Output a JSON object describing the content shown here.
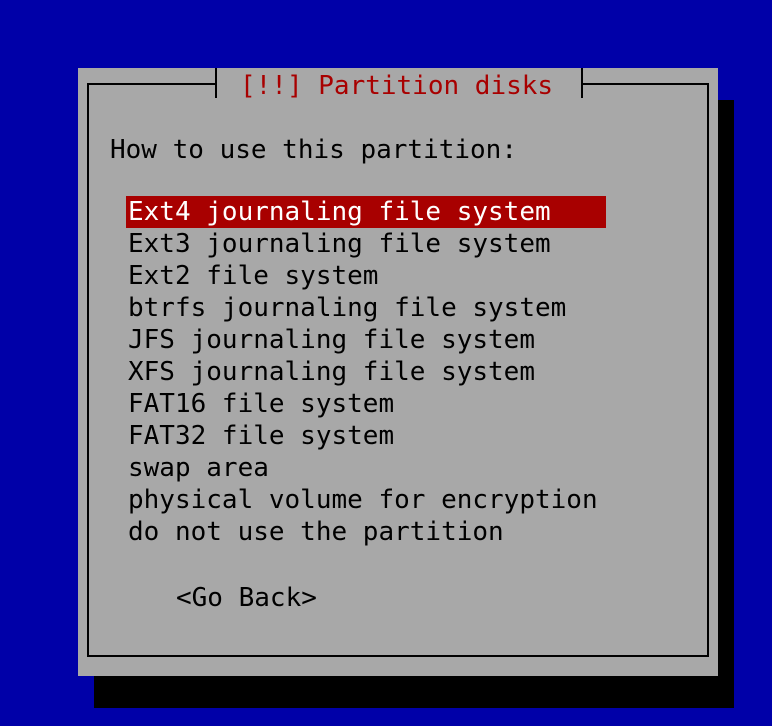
{
  "dialog": {
    "title": "[!!] Partition disks",
    "prompt": "How to use this partition:",
    "options": [
      {
        "label": "Ext4 journaling file system",
        "selected": true
      },
      {
        "label": "Ext3 journaling file system",
        "selected": false
      },
      {
        "label": "Ext2 file system",
        "selected": false
      },
      {
        "label": "btrfs journaling file system",
        "selected": false
      },
      {
        "label": "JFS journaling file system",
        "selected": false
      },
      {
        "label": "XFS journaling file system",
        "selected": false
      },
      {
        "label": "FAT16 file system",
        "selected": false
      },
      {
        "label": "FAT32 file system",
        "selected": false
      },
      {
        "label": "swap area",
        "selected": false
      },
      {
        "label": "physical volume for encryption",
        "selected": false
      },
      {
        "label": "do not use the partition",
        "selected": false
      }
    ],
    "go_back_label": "<Go Back>"
  },
  "colors": {
    "background": "#0000a8",
    "dialog": "#a8a8a8",
    "title": "#a80000",
    "selection": "#a80000",
    "selection_text": "#ffffff",
    "shadow": "#000000"
  }
}
